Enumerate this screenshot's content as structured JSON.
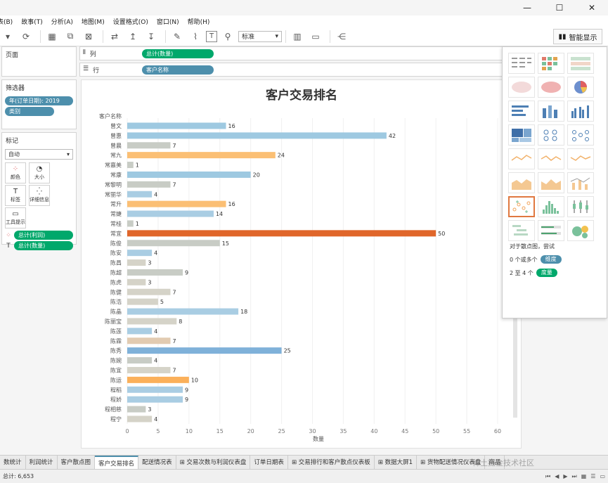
{
  "window": {
    "minimize": "—",
    "maximize": "☐",
    "close": "✕"
  },
  "menu": [
    "表(B)",
    "故事(T)",
    "分析(A)",
    "地图(M)",
    "设置格式(O)",
    "窗口(N)",
    "帮助(H)"
  ],
  "toolbar": {
    "style_select": "标准",
    "smart_label": "智能显示"
  },
  "pages_pane": {
    "title": "页面"
  },
  "filters_pane": {
    "title": "筛选器",
    "filters": [
      "年(订单日期): 2019",
      "类别"
    ]
  },
  "marks_pane": {
    "title": "标记",
    "mark_type": "自动",
    "buttons": [
      {
        "label": "颜色",
        "icon": "color-dots-icon"
      },
      {
        "label": "大小",
        "icon": "size-icon"
      },
      {
        "label": "标签",
        "icon": "label-icon"
      },
      {
        "label": "详细信息",
        "icon": "detail-icon"
      },
      {
        "label": "工具提示",
        "icon": "tooltip-icon"
      }
    ],
    "fields": [
      {
        "pill": "总计(利润)",
        "icon": "color-dots-icon"
      },
      {
        "pill": "总计(数量)",
        "icon": "label-icon"
      }
    ]
  },
  "shelves": {
    "columns": {
      "label": "列",
      "pill": "总计(数量)"
    },
    "rows": {
      "label": "行",
      "pill": "客户名称"
    }
  },
  "showme": {
    "hint": "对于散点图，尝试",
    "line1_prefix": "0 个或多个",
    "line1_pill": "维度",
    "line2_prefix": "2 至 4 个",
    "line2_pill": "度量"
  },
  "chart_data": {
    "type": "bar",
    "title": "客户交易排名",
    "row_header": "客户名称",
    "xlabel": "数量",
    "xlim": [
      0,
      60
    ],
    "xticks": [
      0,
      5,
      10,
      15,
      20,
      25,
      30,
      35,
      40,
      45,
      50,
      55,
      60
    ],
    "categories": [
      "曾文",
      "曾惠",
      "曾晨",
      "常九",
      "常嘉美",
      "常康",
      "常黎明",
      "常丽华",
      "常升",
      "常婕",
      "常桂",
      "常宜",
      "陈俊",
      "陈安",
      "陈昌",
      "陈超",
      "陈虎",
      "陈健",
      "陈浩",
      "陈晶",
      "陈丽宝",
      "陈莲",
      "陈霖",
      "陈秀",
      "陈婉",
      "陈宜",
      "陈运",
      "程稻",
      "程娇",
      "程相慈",
      "程宁"
    ],
    "values": [
      16,
      42,
      7,
      24,
      1,
      20,
      7,
      4,
      16,
      14,
      1,
      50,
      15,
      4,
      3,
      9,
      3,
      7,
      5,
      18,
      8,
      4,
      7,
      25,
      4,
      7,
      10,
      9,
      9,
      3,
      4
    ],
    "colors": [
      "#9ec9e1",
      "#9ec9e1",
      "#c8ccc5",
      "#fbbf74",
      "#c8ccc5",
      "#9ec9e1",
      "#c8ccc5",
      "#a9cde3",
      "#fbbf74",
      "#a9cde3",
      "#c8ccc5",
      "#e0662a",
      "#c8ccc5",
      "#a9cde3",
      "#d5d3c8",
      "#c8ccc5",
      "#d5d3c8",
      "#d5d3c8",
      "#d5d3c8",
      "#a9cde3",
      "#d5d3c8",
      "#a9cde3",
      "#e2cbb1",
      "#7fb1d9",
      "#c8ccc5",
      "#d5d3c8",
      "#fbb05a",
      "#a9cde3",
      "#a9cde3",
      "#c8ccc5",
      "#d5d3c8"
    ]
  },
  "tabs": [
    "数统计",
    "利润统计",
    "客户散点图",
    "客户交易排名",
    "配送情况表",
    "交易次数与利润仪表盘",
    "订单日期表",
    "交易排行和客户散点仪表板",
    "数据大屏1",
    "货物配送情况仪表盘",
    "商品"
  ],
  "active_tab": "客户交易排名",
  "status": {
    "left": "总计: 6,653"
  },
  "watermark": "稀土掘金技术社区"
}
